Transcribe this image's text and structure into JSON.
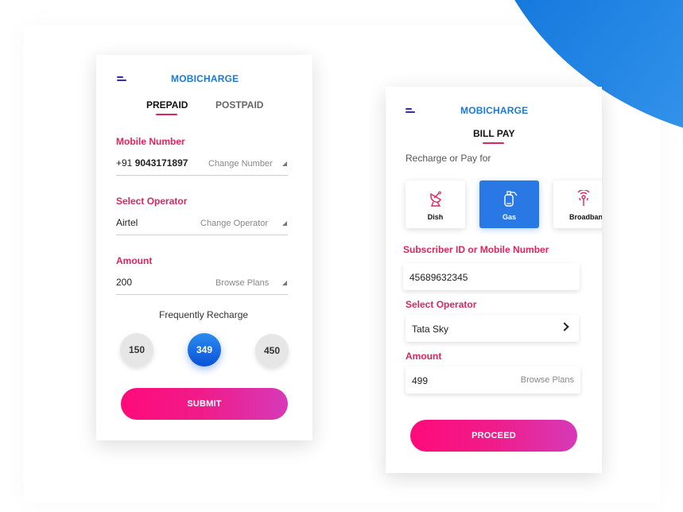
{
  "left_card": {
    "brand": "MOBICHARGE",
    "tabs": [
      {
        "label": "PREPAID",
        "active": true
      },
      {
        "label": "POSTPAID",
        "active": false
      }
    ],
    "mobile": {
      "label": "Mobile Number",
      "prefix": "+91",
      "value": "9043171897",
      "hint": "Change Number"
    },
    "operator": {
      "label": "Select Operator",
      "value": "Airtel",
      "hint": "Change Operator"
    },
    "amount": {
      "label": "Amount",
      "value": "200",
      "hint": "Browse Plans"
    },
    "frequent": {
      "title": "Frequently Recharge",
      "chips": [
        {
          "value": "150",
          "selected": false
        },
        {
          "value": "349",
          "selected": true
        },
        {
          "value": "450",
          "selected": false
        }
      ]
    },
    "submit_label": "SUBMIT"
  },
  "right_card": {
    "brand": "MOBICHARGE",
    "tab": "BILL PAY",
    "subtitle": "Recharge or Pay for",
    "categories": [
      {
        "label": "Dish",
        "icon": "satellite-dish-icon",
        "active": false
      },
      {
        "label": "Gas",
        "icon": "gas-cylinder-icon",
        "active": true
      },
      {
        "label": "Broadband",
        "icon": "broadband-antenna-icon",
        "active": false
      }
    ],
    "subscriber": {
      "label": "Subscriber ID  or Mobile Number",
      "value": "45689632345"
    },
    "operator": {
      "label": "Select Operator",
      "value": "Tata Sky"
    },
    "amount": {
      "label": "Amount",
      "value": "499",
      "hint": "Browse Plans"
    },
    "proceed_label": "PROCEED"
  },
  "colors": {
    "accent_red": "#e0245e",
    "brand_blue": "#1a7ad4",
    "active_tile": "#2a78e4",
    "button_gradient_start": "#ff0a7a",
    "button_gradient_end": "#d63ab8"
  }
}
